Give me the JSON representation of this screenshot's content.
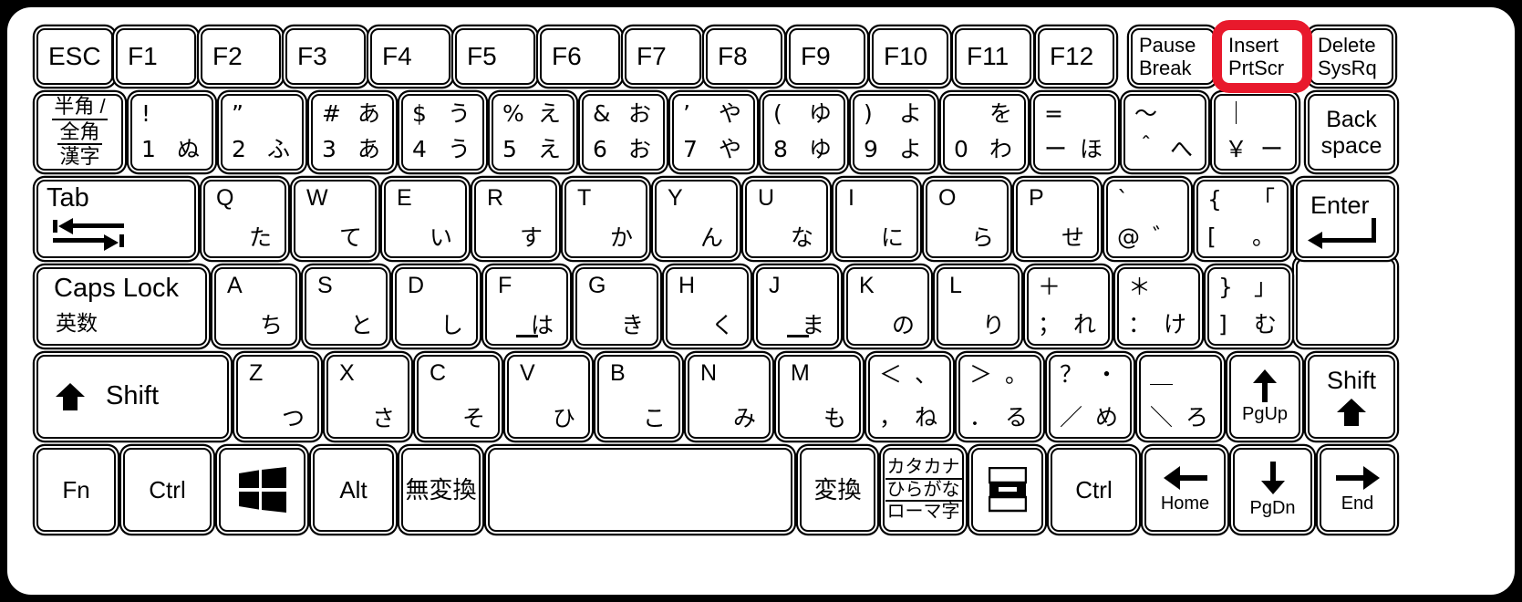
{
  "meta": {
    "title": "Japanese JIS laptop keyboard layout",
    "highlight_color": "#e8192c",
    "key_face_color": "#ffffff",
    "frame_color": "#000000",
    "highlighted_key": "Insert / PrtScr"
  },
  "rows": {
    "function_row": [
      {
        "name": "esc",
        "label": "ESC"
      },
      {
        "name": "f1",
        "label": "F1"
      },
      {
        "name": "f2",
        "label": "F2"
      },
      {
        "name": "f3",
        "label": "F3"
      },
      {
        "name": "f4",
        "label": "F4"
      },
      {
        "name": "f5",
        "label": "F5"
      },
      {
        "name": "f6",
        "label": "F6"
      },
      {
        "name": "f7",
        "label": "F7"
      },
      {
        "name": "f8",
        "label": "F8"
      },
      {
        "name": "f9",
        "label": "F9"
      },
      {
        "name": "f10",
        "label": "F10"
      },
      {
        "name": "f11",
        "label": "F11"
      },
      {
        "name": "f12",
        "label": "F12"
      },
      {
        "name": "pause-break",
        "top": "Pause",
        "bottom": "Break"
      },
      {
        "name": "insert-prtscr",
        "top": "Insert",
        "bottom": "PrtScr"
      },
      {
        "name": "delete-sysrq",
        "top": "Delete",
        "bottom": "SysRq"
      }
    ],
    "number_row": [
      {
        "name": "hankaku-zenkaku",
        "l1": "半角 /",
        "l2": "全角",
        "l3": "漢字"
      },
      {
        "name": "digit-1",
        "ul": "!",
        "ur": "",
        "ll": "1",
        "lr": "ぬ"
      },
      {
        "name": "digit-2",
        "ul": "”",
        "ur": "",
        "ll": "2",
        "lr": "ふ"
      },
      {
        "name": "digit-3",
        "ul": "#",
        "ur": "あ",
        "ll": "3",
        "lr": "あ"
      },
      {
        "name": "digit-4",
        "ul": "$",
        "ur": "う",
        "ll": "4",
        "lr": "う"
      },
      {
        "name": "digit-5",
        "ul": "%",
        "ur": "え",
        "ll": "5",
        "lr": "え"
      },
      {
        "name": "digit-6",
        "ul": "&",
        "ur": "お",
        "ll": "6",
        "lr": "お"
      },
      {
        "name": "digit-7",
        "ul": "’",
        "ur": "や",
        "ll": "7",
        "lr": "や"
      },
      {
        "name": "digit-8",
        "ul": "(",
        "ur": "ゆ",
        "ll": "8",
        "lr": "ゆ"
      },
      {
        "name": "digit-9",
        "ul": ")",
        "ur": "よ",
        "ll": "9",
        "lr": "よ"
      },
      {
        "name": "digit-0",
        "ul": "",
        "ur": "を",
        "ll": "0",
        "lr": "わ"
      },
      {
        "name": "minus",
        "ul": "=",
        "ur": "",
        "ll": "ー",
        "lr": "ほ"
      },
      {
        "name": "caret",
        "ul": "～",
        "ur": "",
        "ll": "＾",
        "lr": "へ"
      },
      {
        "name": "yen",
        "ul": "｜",
        "ur": "",
        "ll": "￥",
        "lr": "ー"
      },
      {
        "name": "backspace",
        "top": "Back",
        "bottom": "space"
      }
    ],
    "qwerty_row": [
      {
        "name": "tab",
        "label": "Tab",
        "icon": "tab-arrows-icon"
      },
      {
        "name": "key-q",
        "letter": "Q",
        "kana": "た"
      },
      {
        "name": "key-w",
        "letter": "W",
        "kana": "て"
      },
      {
        "name": "key-e",
        "letter": "E",
        "kana": "い"
      },
      {
        "name": "key-r",
        "letter": "R",
        "kana": "す"
      },
      {
        "name": "key-t",
        "letter": "T",
        "kana": "か"
      },
      {
        "name": "key-y",
        "letter": "Y",
        "kana": "ん"
      },
      {
        "name": "key-u",
        "letter": "U",
        "kana": "な"
      },
      {
        "name": "key-i",
        "letter": "I",
        "kana": "に"
      },
      {
        "name": "key-o",
        "letter": "O",
        "kana": "ら"
      },
      {
        "name": "key-p",
        "letter": "P",
        "kana": "せ"
      },
      {
        "name": "at",
        "ul": "`",
        "ur": "",
        "ll": "@",
        "lr": "゛"
      },
      {
        "name": "bracket-left",
        "ul": "{",
        "ur": "「",
        "ll": "[",
        "lr": "。"
      },
      {
        "name": "enter",
        "label": "Enter",
        "icon": "enter-arrow-icon"
      }
    ],
    "home_row": [
      {
        "name": "caps-lock",
        "label": "Caps Lock",
        "sub": "英数"
      },
      {
        "name": "key-a",
        "letter": "A",
        "kana": "ち"
      },
      {
        "name": "key-s",
        "letter": "S",
        "kana": "と"
      },
      {
        "name": "key-d",
        "letter": "D",
        "kana": "し"
      },
      {
        "name": "key-f",
        "letter": "F",
        "kana": "は",
        "homing": true
      },
      {
        "name": "key-g",
        "letter": "G",
        "kana": "き"
      },
      {
        "name": "key-h",
        "letter": "H",
        "kana": "く"
      },
      {
        "name": "key-j",
        "letter": "J",
        "kana": "ま",
        "homing": true
      },
      {
        "name": "key-k",
        "letter": "K",
        "kana": "の"
      },
      {
        "name": "key-l",
        "letter": "L",
        "kana": "り"
      },
      {
        "name": "semicolon",
        "ul": "＋",
        "ur": "",
        "ll": "；",
        "lr": "れ"
      },
      {
        "name": "colon",
        "ul": "＊",
        "ur": "",
        "ll": "：",
        "lr": "け"
      },
      {
        "name": "bracket-right",
        "ul": "}",
        "ur": "」",
        "ll": "]",
        "lr": "む"
      }
    ],
    "shift_row": [
      {
        "name": "shift-left",
        "label": "Shift",
        "icon": "shift-arrow-icon"
      },
      {
        "name": "key-z",
        "letter": "Z",
        "kana": "つ"
      },
      {
        "name": "key-x",
        "letter": "X",
        "kana": "さ"
      },
      {
        "name": "key-c",
        "letter": "C",
        "kana": "そ"
      },
      {
        "name": "key-v",
        "letter": "V",
        "kana": "ひ"
      },
      {
        "name": "key-b",
        "letter": "B",
        "kana": "こ"
      },
      {
        "name": "key-n",
        "letter": "N",
        "kana": "み"
      },
      {
        "name": "key-m",
        "letter": "M",
        "kana": "も"
      },
      {
        "name": "comma",
        "ul": "＜",
        "ur": "、",
        "ll": "，",
        "lr": "ね"
      },
      {
        "name": "period",
        "ul": "＞",
        "ur": "。",
        "ll": "．",
        "lr": "る"
      },
      {
        "name": "slash",
        "ul": "？",
        "ur": "・",
        "ll": "／",
        "lr": "め"
      },
      {
        "name": "backslash",
        "ul": "＿",
        "ur": "",
        "ll": "＼",
        "lr": "ろ"
      },
      {
        "name": "up-pgup",
        "icon": "arrow-up-icon",
        "sub": "PgUp"
      },
      {
        "name": "shift-right",
        "label": "Shift",
        "icon": "shift-arrow-icon"
      }
    ],
    "bottom_row": [
      {
        "name": "fn",
        "label": "Fn"
      },
      {
        "name": "ctrl-left",
        "label": "Ctrl"
      },
      {
        "name": "windows",
        "icon": "windows-logo-icon"
      },
      {
        "name": "alt",
        "label": "Alt"
      },
      {
        "name": "muhenkan",
        "label": "無変換"
      },
      {
        "name": "space",
        "label": ""
      },
      {
        "name": "henkan",
        "label": "変換"
      },
      {
        "name": "katakana-hiragana",
        "l1": "カタカナ",
        "l2": "ひらがな",
        "l3": "ローマ字"
      },
      {
        "name": "menu",
        "icon": "context-menu-icon"
      },
      {
        "name": "ctrl-right",
        "label": "Ctrl"
      },
      {
        "name": "left-home",
        "icon": "arrow-left-icon",
        "sub": "Home"
      },
      {
        "name": "down-pgdn",
        "icon": "arrow-down-icon",
        "sub": "PgDn"
      },
      {
        "name": "right-end",
        "icon": "arrow-right-icon",
        "sub": "End"
      }
    ]
  }
}
